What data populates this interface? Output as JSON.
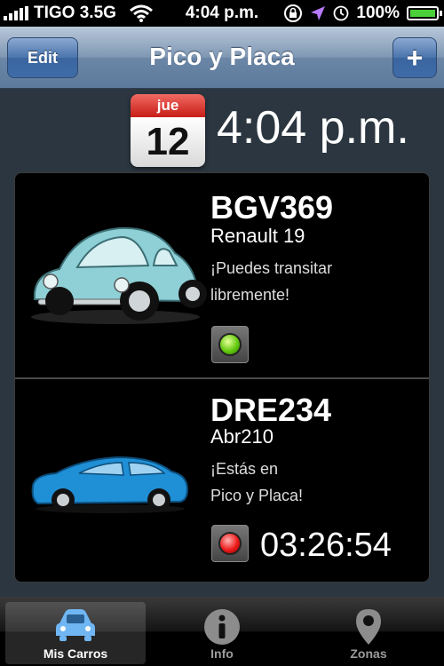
{
  "status_bar": {
    "carrier": "TIGO 3.5G",
    "time": "4:04 p.m.",
    "battery": "100%",
    "icons": [
      "signal-icon",
      "wifi-icon",
      "rotation-lock-icon",
      "location-icon",
      "alarm-icon",
      "battery-icon"
    ]
  },
  "nav": {
    "title": "Pico y Placa",
    "edit_label": "Edit",
    "add_label": "+"
  },
  "date": {
    "weekday": "jue",
    "day": "12",
    "time": "4:04 p.m."
  },
  "cars": [
    {
      "plate": "BGV369",
      "model": "Renault 19",
      "message_line1": "¡Puedes transitar",
      "message_line2": "libremente!",
      "status": "green"
    },
    {
      "plate": "DRE234",
      "model": "Abr210",
      "message_line1": "¡Estás en",
      "message_line2": "Pico y Placa!",
      "status": "red",
      "countdown": "03:26:54"
    }
  ],
  "tabs": [
    {
      "label": "Mis Carros",
      "icon": "car-icon",
      "active": true
    },
    {
      "label": "Info",
      "icon": "info-icon",
      "active": false
    },
    {
      "label": "Zonas",
      "icon": "map-pin-icon",
      "active": false
    }
  ],
  "colors": {
    "nav_blue": "#6b86a6",
    "calendar_red": "#c81d17",
    "light_green": "#63c90f",
    "light_red": "#ee1b1b"
  }
}
